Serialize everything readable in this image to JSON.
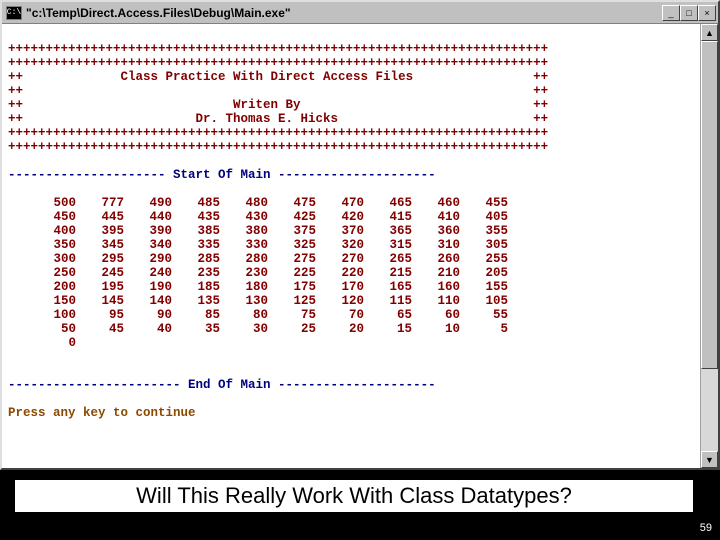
{
  "titlebar": {
    "icon_label": "C:\\",
    "title": "\"c:\\Temp\\Direct.Access.Files\\Debug\\Main.exe\"",
    "min": "_",
    "max": "□",
    "close": "×"
  },
  "header": {
    "border_full": "++++++++++++++++++++++++++++++++++++++++++++++++++++++++++++++++++++++++",
    "line1": "++             Class Practice With Direct Access Files                ++",
    "line2": "++                                                                    ++",
    "line3": "++                            Writen By                               ++",
    "line4": "++                       Dr. Thomas E. Hicks                          ++"
  },
  "sep_start": "--------------------- Start Of Main ---------------------",
  "sep_end": "----------------------- End Of Main ---------------------",
  "grid": [
    [
      "500",
      "777",
      "490",
      "485",
      "480",
      "475",
      "470",
      "465",
      "460",
      "455"
    ],
    [
      "450",
      "445",
      "440",
      "435",
      "430",
      "425",
      "420",
      "415",
      "410",
      "405"
    ],
    [
      "400",
      "395",
      "390",
      "385",
      "380",
      "375",
      "370",
      "365",
      "360",
      "355"
    ],
    [
      "350",
      "345",
      "340",
      "335",
      "330",
      "325",
      "320",
      "315",
      "310",
      "305"
    ],
    [
      "300",
      "295",
      "290",
      "285",
      "280",
      "275",
      "270",
      "265",
      "260",
      "255"
    ],
    [
      "250",
      "245",
      "240",
      "235",
      "230",
      "225",
      "220",
      "215",
      "210",
      "205"
    ],
    [
      "200",
      "195",
      "190",
      "185",
      "180",
      "175",
      "170",
      "165",
      "160",
      "155"
    ],
    [
      "150",
      "145",
      "140",
      "135",
      "130",
      "125",
      "120",
      "115",
      "110",
      "105"
    ],
    [
      "100",
      " 95",
      " 90",
      " 85",
      " 80",
      " 75",
      " 70",
      " 65",
      " 60",
      " 55"
    ],
    [
      " 50",
      " 45",
      " 40",
      " 35",
      " 30",
      " 25",
      " 20",
      " 15",
      " 10",
      "  5"
    ],
    [
      "  0",
      "",
      "",
      "",
      "",
      "",
      "",
      "",
      "",
      ""
    ]
  ],
  "prompt": "Press any key to continue",
  "scrollbar": {
    "up": "▲",
    "down": "▼"
  },
  "caption": "Will This Really Work With Class Datatypes?",
  "page_number": "59"
}
